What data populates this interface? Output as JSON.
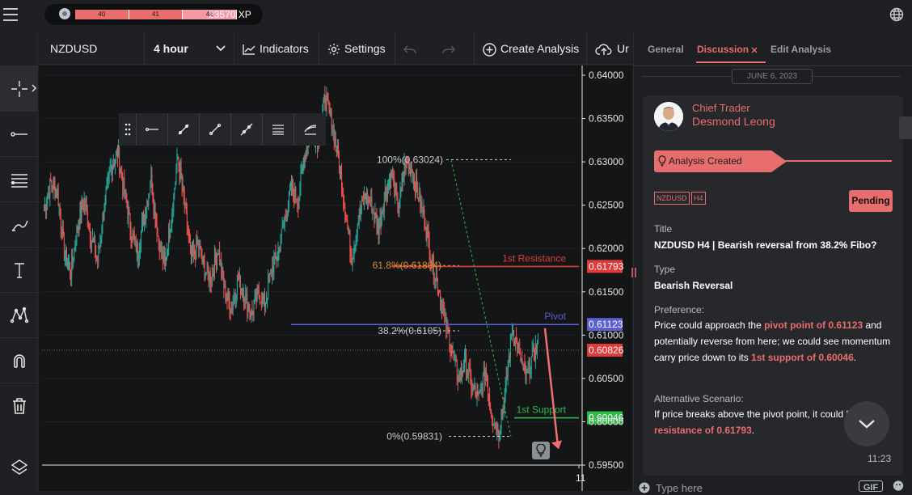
{
  "topbar": {
    "xp_levels": [
      "40",
      "41",
      "42"
    ],
    "xp_text": "23570 XP"
  },
  "toolbar": {
    "symbol": "NZDUSD",
    "interval": "4 hour",
    "indicators": "Indicators",
    "settings": "Settings",
    "create_analysis": "Create Analysis",
    "upload": "Ur"
  },
  "chart_data": {
    "type": "candlestick",
    "symbol": "NZDUSD",
    "interval": "4 hour",
    "y_ticks": [
      "0.64000",
      "0.63500",
      "0.63000",
      "0.62500",
      "0.62000",
      "0.61500",
      "0.61000",
      "0.60500",
      "0.60000",
      "0.59500"
    ],
    "ylim": [
      0.595,
      0.64
    ],
    "x_tick": "11",
    "close_path": [
      0.6245,
      0.6275,
      0.6265,
      0.6195,
      0.6175,
      0.6225,
      0.6255,
      0.6215,
      0.6185,
      0.625,
      0.6295,
      0.631,
      0.6265,
      0.622,
      0.6195,
      0.624,
      0.628,
      0.6215,
      0.618,
      0.6235,
      0.6305,
      0.625,
      0.6185,
      0.6205,
      0.6175,
      0.6165,
      0.62,
      0.615,
      0.613,
      0.6165,
      0.6145,
      0.6125,
      0.615,
      0.6135,
      0.6175,
      0.6195,
      0.6235,
      0.627,
      0.6255,
      0.631,
      0.634,
      0.6325,
      0.6375,
      0.6345,
      0.6305,
      0.6245,
      0.619,
      0.6235,
      0.626,
      0.625,
      0.622,
      0.6265,
      0.6285,
      0.6245,
      0.63,
      0.629,
      0.626,
      0.623,
      0.6185,
      0.6155,
      0.6115,
      0.608,
      0.605,
      0.607,
      0.604,
      0.6025,
      0.606,
      0.6005,
      0.599,
      0.6035,
      0.611,
      0.608,
      0.605,
      0.6075,
      0.609
    ],
    "levels": [
      {
        "label": "1st Resistance",
        "value": 0.61793,
        "value_label": "0.61793",
        "color": "#e03b3b"
      },
      {
        "label": "Pivot",
        "value": 0.61123,
        "value_label": "0.61123",
        "color": "#5a5fd1"
      },
      {
        "label": "1st Support",
        "value": 0.60046,
        "value_label": "0.60046",
        "color": "#2fb84a"
      }
    ],
    "current_price": {
      "value": 0.60826,
      "value_label": "0.60826",
      "color": "#e03b3b"
    },
    "fib_levels": [
      {
        "label": "100%(0.63024)",
        "value": 0.63024,
        "color": "#c8c8c8"
      },
      {
        "label": "61.8%(0.61804)",
        "value": 0.61804,
        "color": "#d7922d"
      },
      {
        "label": "38.2%(0.6105)",
        "value": 0.6105,
        "color": "#c8c8c8"
      },
      {
        "label": "0%(0.59831)",
        "value": 0.59831,
        "color": "#c8c8c8"
      }
    ],
    "colors": {
      "up": "#26a69a",
      "down": "#ef5350",
      "background": "#141517"
    }
  },
  "panel": {
    "tabs": [
      "General",
      "Discussion",
      "Edit Analysis"
    ],
    "date": "JUNE 6, 2023",
    "role": "Chief Trader",
    "name": "Desmond Leong",
    "banner": "Analysis Created",
    "tags": [
      "NZDUSD",
      "H4"
    ],
    "status": "Pending",
    "title_label": "Title",
    "title_value": "NZDUSD H4 | Bearish reversal from 38.2% Fibo?",
    "type_label": "Type",
    "type_value": "Bearish Reversal",
    "pref_label": "Preference:",
    "pref_1": "Price could approach the ",
    "pref_hl1": "pivot point of 0.61123",
    "pref_2": " and potentially reverse from here; we could see momentum carry price down to its ",
    "pref_hl2": "1st support of 0.60046",
    "pref_3": ".",
    "alt_label": "Alternative Scenario:",
    "alt_1": "If price breaks above the pivot point, it could h",
    "alt_hl": "resistance of 0.61793",
    "alt_2": ".",
    "time": "11:23",
    "input_placeholder": "Type here",
    "gif": "GIF"
  }
}
